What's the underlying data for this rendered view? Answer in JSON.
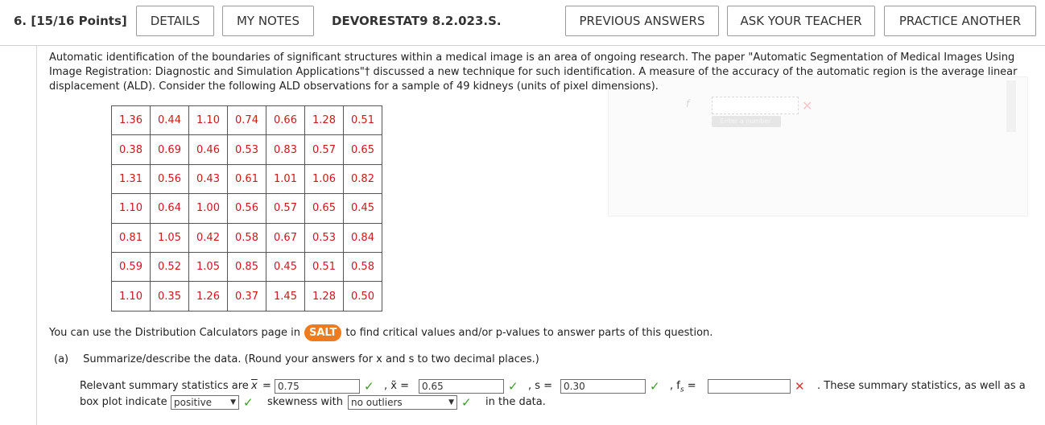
{
  "header": {
    "question_number": "6.",
    "points": "[15/16 Points]",
    "details_label": "DETAILS",
    "notes_label": "MY NOTES",
    "code": "DEVORESTAT9 8.2.023.S.",
    "previous_label": "PREVIOUS ANSWERS",
    "ask_label": "ASK YOUR TEACHER",
    "practice_label": "PRACTICE ANOTHER"
  },
  "intro": "Automatic identification of the boundaries of significant structures within a medical image is an area of ongoing research. The paper \"Automatic Segmentation of Medical Images Using Image Registration: Diagnostic and Simulation Applications\"† discussed a new technique for such identification. A measure of the accuracy of the automatic region is the average linear displacement (ALD). Consider the following ALD observations for a sample of 49 kidneys (units of pixel dimensions).",
  "ghost": {
    "label": "f",
    "tip": "Enter a number."
  },
  "table": [
    [
      "1.36",
      "0.44",
      "1.10",
      "0.74",
      "0.66",
      "1.28",
      "0.51"
    ],
    [
      "0.38",
      "0.69",
      "0.46",
      "0.53",
      "0.83",
      "0.57",
      "0.65"
    ],
    [
      "1.31",
      "0.56",
      "0.43",
      "0.61",
      "1.01",
      "1.06",
      "0.82"
    ],
    [
      "1.10",
      "0.64",
      "1.00",
      "0.56",
      "0.57",
      "0.65",
      "0.45"
    ],
    [
      "0.81",
      "1.05",
      "0.42",
      "0.58",
      "0.67",
      "0.53",
      "0.84"
    ],
    [
      "0.59",
      "0.52",
      "1.05",
      "0.85",
      "0.45",
      "0.51",
      "0.58"
    ],
    [
      "1.10",
      "0.35",
      "1.26",
      "0.37",
      "1.45",
      "1.28",
      "0.50"
    ]
  ],
  "salt": {
    "before": "You can use the Distribution Calculators page in",
    "badge": "SALT",
    "after": "to find critical values and/or p-values to answer parts of this question."
  },
  "part_a": {
    "label": "(a)",
    "prompt": "Summarize/describe the data. (Round your answers for x and s to two decimal places.)",
    "line1_prefix": "Relevant summary statistics are",
    "xbar_sym": "x",
    "eq": "=",
    "xbar_value": "0.75",
    "xtilde_prefix": ", x̃ =",
    "xtilde_value": "0.65",
    "s_prefix": ", s =",
    "s_value": "0.30",
    "fs_prefix": ", f",
    "fs_sub": "s",
    "fs_eq": "=",
    "fs_value": "",
    "line1_suffix": ". These summary statistics, as well as a",
    "line2_prefix": "box plot indicate",
    "skew_select": "positive",
    "line2_mid": "skewness with",
    "outlier_select": "no outliers",
    "line2_suffix": "in the data."
  },
  "colors": {
    "accent": "#f07a1c",
    "data_text": "#c21d1d",
    "correct": "#3c9a2a",
    "incorrect": "#d23838"
  }
}
